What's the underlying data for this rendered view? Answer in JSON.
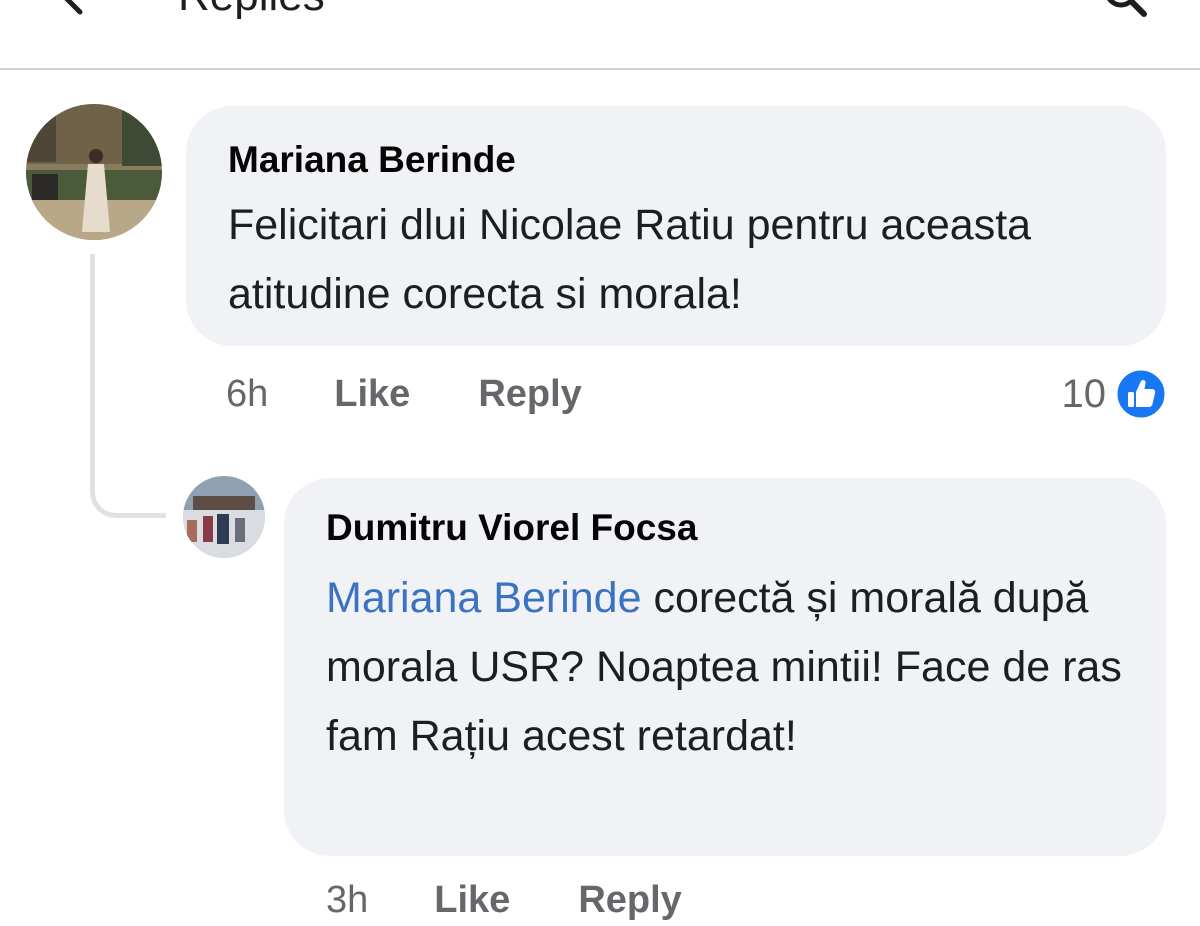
{
  "header": {
    "title": "Replies",
    "back_icon": "arrow-left-icon",
    "search_icon": "search-icon"
  },
  "comments": [
    {
      "author": "Mariana Berinde",
      "text": "Felicitari dlui Nicolae Ratiu pentru aceasta atitudine corecta si morala!",
      "time": "6h",
      "like_label": "Like",
      "reply_label": "Reply",
      "reaction_count": "10",
      "reaction_icon": "like-icon"
    },
    {
      "author": "Dumitru Viorel Focsa",
      "mention": "Mariana Berinde",
      "text": " corectă și morală după morala USR? Noaptea mintii! Face de ras fam Rațiu acest retardat!",
      "time": "3h",
      "like_label": "Like",
      "reply_label": "Reply"
    }
  ],
  "colors": {
    "bubble": "#f0f2f5",
    "mention": "#3b73c0",
    "meta_text": "#65676b",
    "like_blue": "#1877f2"
  }
}
